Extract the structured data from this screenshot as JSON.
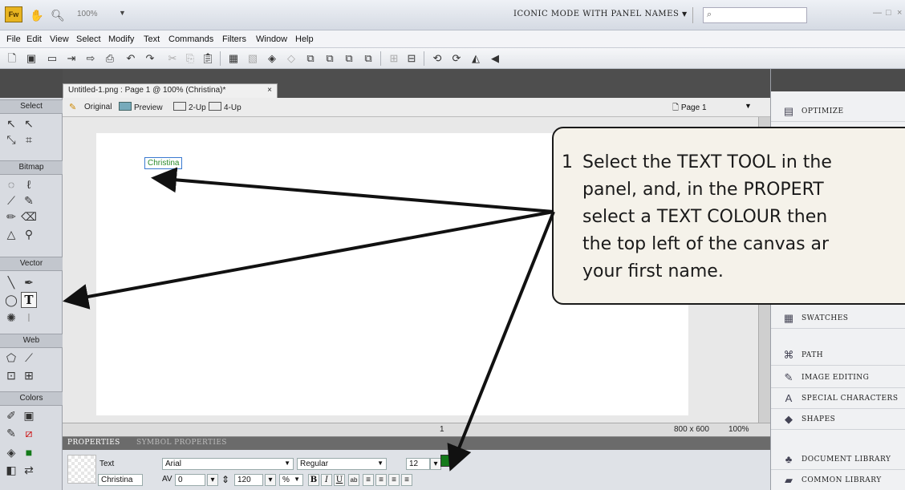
{
  "titlebar": {
    "logo": "Fw",
    "zoom": "100%",
    "workspace": "ICONIC MODE WITH PANEL NAMES",
    "workspace_caret": "▼",
    "search_icon": "search-icon"
  },
  "menu": [
    "File",
    "Edit",
    "View",
    "Select",
    "Modify",
    "Text",
    "Commands",
    "Filters",
    "Window",
    "Help"
  ],
  "document": {
    "tab_title": "Untitled-1.png : Page 1 @ 100% (Christina)*",
    "tab_close": "×",
    "views": [
      "Original",
      "Preview",
      "2-Up",
      "4-Up"
    ],
    "page": "Page 1",
    "text_object": "Christina",
    "status_page": "1",
    "canvas_size": "800 x 600",
    "zoom": "100%"
  },
  "tools": {
    "sections": [
      "Select",
      "Bitmap",
      "Vector",
      "Web",
      "Colors"
    ]
  },
  "properties": {
    "tabs": [
      "PROPERTIES",
      "SYMBOL PROPERTIES"
    ],
    "object_type": "Text",
    "object_name": "Christina",
    "font": "Arial",
    "style": "Regular",
    "size": "12",
    "kerning": "0",
    "leading": "120",
    "leading_unit": "%",
    "bold": "B",
    "italic": "I",
    "underline": "U",
    "text_color": "#147a1a"
  },
  "panels": [
    {
      "label": "OPTIMIZE",
      "icon": "optimize-icon"
    },
    {
      "label": "SWATCHES",
      "icon": "swatches-icon"
    },
    {
      "label": "PATH",
      "icon": "path-icon"
    },
    {
      "label": "IMAGE EDITING",
      "icon": "image-editing-icon"
    },
    {
      "label": "SPECIAL CHARACTERS",
      "icon": "special-characters-icon"
    },
    {
      "label": "SHAPES",
      "icon": "shapes-icon"
    },
    {
      "label": "DOCUMENT LIBRARY",
      "icon": "document-library-icon"
    },
    {
      "label": "COMMON LIBRARY",
      "icon": "common-library-icon"
    }
  ],
  "callout": {
    "number": "1",
    "text": "Select the TEXT TOOL in the\npanel, and, in the PROPERT\nselect a TEXT COLOUR then\nthe top left of the canvas ar\nyour first name."
  }
}
